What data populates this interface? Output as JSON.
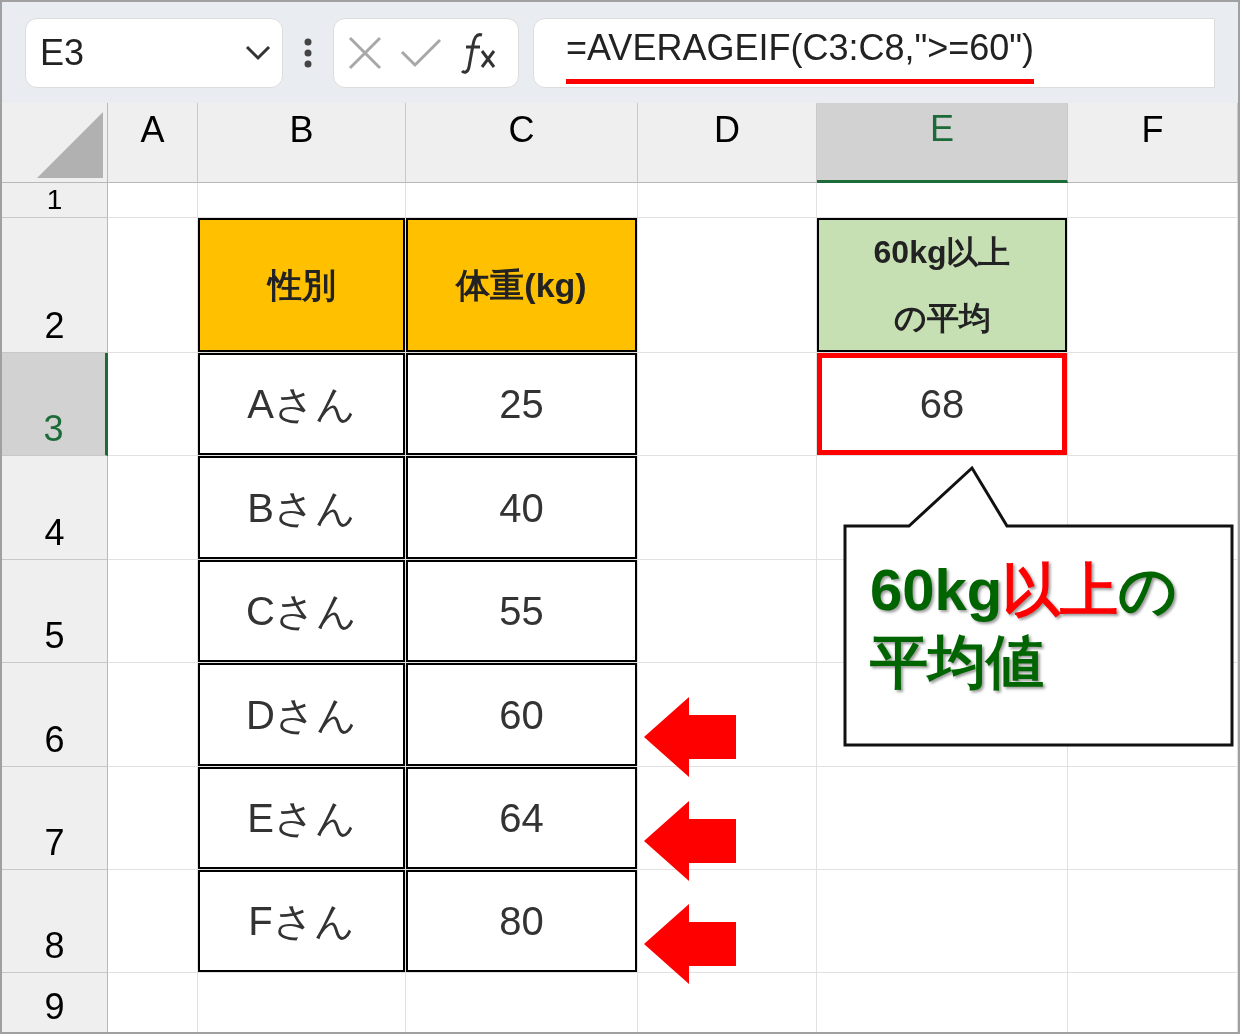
{
  "formula_bar": {
    "name_box": "E3",
    "formula": "=AVERAGEIF(C3:C8,\">=60\")",
    "formula_underlined": true
  },
  "columns": [
    {
      "label": "A",
      "selected": false
    },
    {
      "label": "B",
      "selected": false
    },
    {
      "label": "C",
      "selected": false
    },
    {
      "label": "D",
      "selected": false
    },
    {
      "label": "E",
      "selected": true
    },
    {
      "label": "F",
      "selected": false
    }
  ],
  "rows": [
    {
      "label": "1",
      "selected": false,
      "arrow": false,
      "cells": {}
    },
    {
      "label": "2",
      "selected": false,
      "arrow": false,
      "cells": {
        "B": {
          "kind": "header",
          "text": "性別"
        },
        "C": {
          "kind": "header",
          "text": "体重(kg)"
        },
        "E": {
          "kind": "result_header",
          "lines": [
            "60kg以上",
            "の平均"
          ]
        }
      }
    },
    {
      "label": "3",
      "selected": true,
      "arrow": false,
      "cells": {
        "B": {
          "kind": "data",
          "text": "Aさん"
        },
        "C": {
          "kind": "data",
          "text": "25"
        },
        "E": {
          "kind": "result",
          "text": "68",
          "highlighted": true
        }
      }
    },
    {
      "label": "4",
      "selected": false,
      "arrow": false,
      "cells": {
        "B": {
          "kind": "data",
          "text": "Bさん"
        },
        "C": {
          "kind": "data",
          "text": "40"
        }
      }
    },
    {
      "label": "5",
      "selected": false,
      "arrow": false,
      "cells": {
        "B": {
          "kind": "data",
          "text": "Cさん"
        },
        "C": {
          "kind": "data",
          "text": "55"
        }
      }
    },
    {
      "label": "6",
      "selected": false,
      "arrow": true,
      "cells": {
        "B": {
          "kind": "data",
          "text": "Dさん"
        },
        "C": {
          "kind": "data",
          "text": "60"
        }
      }
    },
    {
      "label": "7",
      "selected": false,
      "arrow": true,
      "cells": {
        "B": {
          "kind": "data",
          "text": "Eさん"
        },
        "C": {
          "kind": "data",
          "text": "64"
        }
      }
    },
    {
      "label": "8",
      "selected": false,
      "arrow": true,
      "cells": {
        "B": {
          "kind": "data",
          "text": "Fさん"
        },
        "C": {
          "kind": "data",
          "text": "80"
        }
      }
    },
    {
      "label": "9",
      "selected": false,
      "arrow": false,
      "cells": {}
    }
  ],
  "callout": {
    "lines": [
      [
        {
          "text": "60kg",
          "emphasis": false
        },
        {
          "text": "以上",
          "emphasis": true
        },
        {
          "text": "の",
          "emphasis": false
        }
      ],
      [
        {
          "text": "平均値",
          "emphasis": false
        }
      ]
    ]
  }
}
